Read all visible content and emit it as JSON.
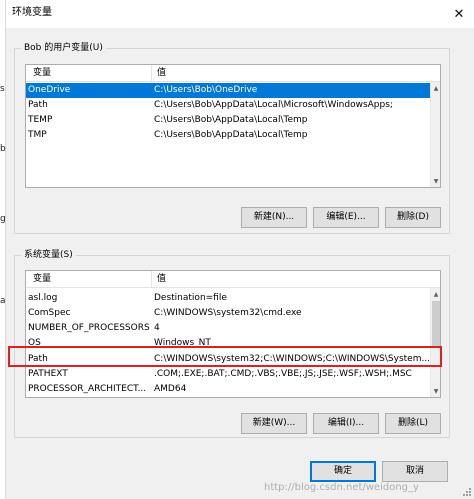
{
  "window": {
    "title": "环境变量"
  },
  "left_strip_chars": [
    "s",
    "b",
    "g",
    "a"
  ],
  "user_vars": {
    "group_label": "Bob 的用户变量(U)",
    "columns": [
      "变量",
      "值"
    ],
    "rows": [
      {
        "name": "OneDrive",
        "value": "C:\\Users\\Bob\\OneDrive",
        "selected": true
      },
      {
        "name": "Path",
        "value": "C:\\Users\\Bob\\AppData\\Local\\Microsoft\\WindowsApps;",
        "selected": false
      },
      {
        "name": "TEMP",
        "value": "C:\\Users\\Bob\\AppData\\Local\\Temp",
        "selected": false
      },
      {
        "name": "TMP",
        "value": "C:\\Users\\Bob\\AppData\\Local\\Temp",
        "selected": false
      }
    ],
    "buttons": {
      "new": "新建(N)...",
      "edit": "编辑(E)...",
      "delete": "删除(D)"
    }
  },
  "system_vars": {
    "group_label": "系统变量(S)",
    "columns": [
      "变量",
      "值"
    ],
    "rows": [
      {
        "name": "asl.log",
        "value": "Destination=file"
      },
      {
        "name": "ComSpec",
        "value": "C:\\WINDOWS\\system32\\cmd.exe"
      },
      {
        "name": "NUMBER_OF_PROCESSORS",
        "value": "4"
      },
      {
        "name": "OS",
        "value": "Windows_NT"
      },
      {
        "name": "Path",
        "value": "C:\\WINDOWS\\system32;C:\\WINDOWS;C:\\WINDOWS\\System...",
        "highlighted": true
      },
      {
        "name": "PATHEXT",
        "value": ".COM;.EXE;.BAT;.CMD;.VBS;.VBE;.JS;.JSE;.WSF;.WSH;.MSC"
      },
      {
        "name": "PROCESSOR_ARCHITECT...",
        "value": "AMD64"
      }
    ],
    "buttons": {
      "new": "新建(W)...",
      "edit": "编辑(I)...",
      "delete": "删除(L)"
    }
  },
  "footer": {
    "ok": "确定",
    "cancel": "取消"
  },
  "watermark": "http://blog.csdn.net/weidong_y",
  "colors": {
    "selection": "#0078d7",
    "highlight_box": "#e02020",
    "button_face": "#e1e1e1"
  },
  "icons": {
    "close": "close-icon",
    "scroll_up": "chevron-up-icon",
    "scroll_down": "chevron-down-icon",
    "resize": "resize-grip-icon"
  }
}
